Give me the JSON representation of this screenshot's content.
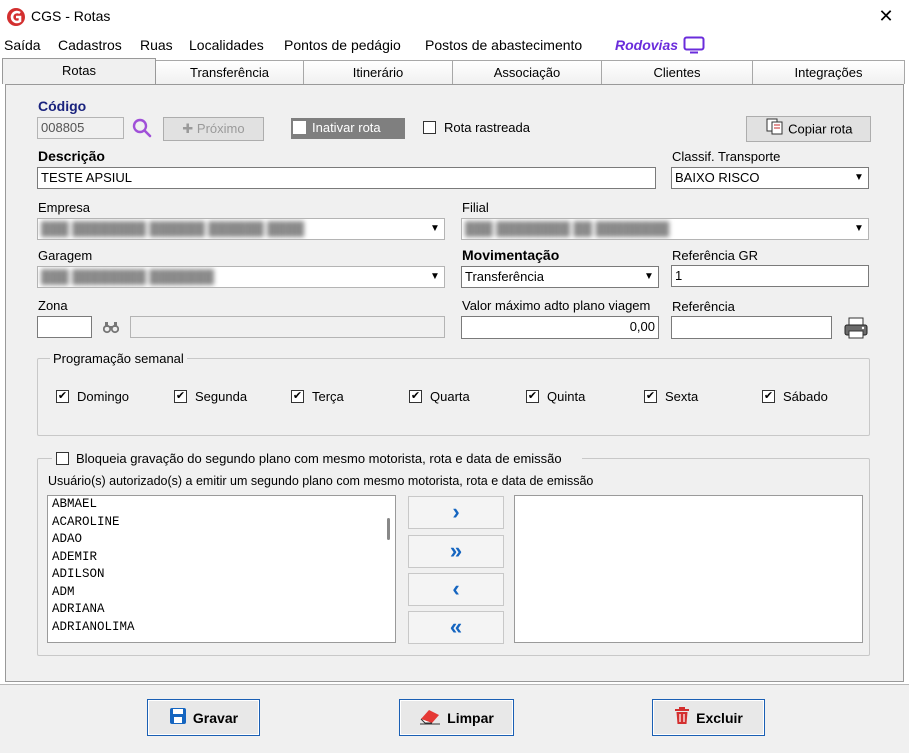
{
  "window": {
    "title": "CGS - Rotas"
  },
  "menu": {
    "items": [
      "Saída",
      "Cadastros",
      "Ruas",
      "Localidades",
      "Pontos de pedágio",
      "Postos de abastecimento"
    ],
    "rodovias": "Rodovias"
  },
  "tabs": [
    "Rotas",
    "Transferência",
    "Itinerário",
    "Associação",
    "Clientes",
    "Integrações"
  ],
  "active_tab": "Rotas",
  "form": {
    "codigo_label": "Código",
    "codigo_value": "008805",
    "proximo_label": "Próximo",
    "inativar_label": "Inativar rota",
    "rastreada_label": "Rota rastreada",
    "copiar_label": "Copiar rota",
    "descricao_label": "Descrição",
    "descricao_value": "TESTE APSIUL",
    "classif_label": "Classif. Transporte",
    "classif_value": "BAIXO RISCO",
    "empresa_label": "Empresa",
    "filial_label": "Filial",
    "garagem_label": "Garagem",
    "movimentacao_label": "Movimentação",
    "movimentacao_value": "Transferência",
    "ref_gr_label": "Referência GR",
    "ref_gr_value": "1",
    "zona_label": "Zona",
    "valor_label": "Valor máximo adto plano viagem",
    "valor_value": "0,00",
    "referencia_label": "Referência"
  },
  "programacao": {
    "title": "Programação semanal",
    "days": [
      "Domingo",
      "Segunda",
      "Terça",
      "Quarta",
      "Quinta",
      "Sexta",
      "Sábado"
    ]
  },
  "bloqueio": {
    "title": "Bloqueia gravação do segundo plano com mesmo motorista, rota e data de emissão",
    "users_label": "Usuário(s) autorizado(s) a emitir um segundo plano com mesmo motorista, rota e data de emissão",
    "users": [
      "ABMAEL",
      "ACAROLINE",
      "ADAO",
      "ADEMIR",
      "ADILSON",
      "ADM",
      "ADRIANA",
      "ADRIANOLIMA"
    ]
  },
  "buttons": {
    "gravar": "Gravar",
    "limpar": "Limpar",
    "excluir": "Excluir"
  },
  "colors": {
    "accent": "#1565c0",
    "rodovias": "#6a2cdb",
    "logo": "#d32f2f"
  }
}
